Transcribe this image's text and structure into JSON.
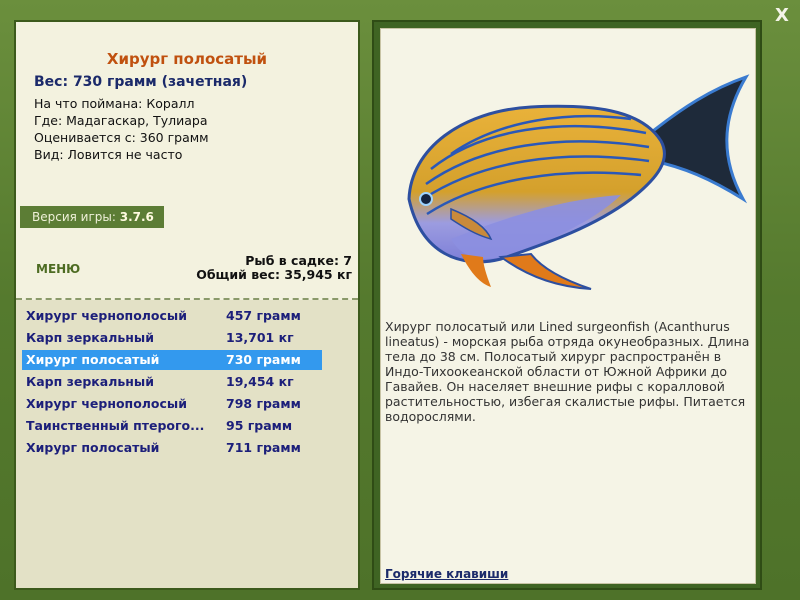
{
  "window": {
    "close_label": "X"
  },
  "fish": {
    "title": "Хирург полосатый",
    "weight": "Вес: 730 грамм (зачетная)",
    "caught_on": "На что поймана: Коралл",
    "location": "Где: Мадагаскар, Тулиара",
    "valued_from": "Оценивается с: 360 грамм",
    "kind": "Вид: Ловится не часто"
  },
  "version": {
    "label": "Версия игры:",
    "value": "3.7.6"
  },
  "menu": {
    "label": "МЕНЮ"
  },
  "stats": {
    "fish_in_keepnet": "Рыб в садке: 7",
    "total_weight": "Общий вес: 35,945 кг"
  },
  "catch_list": [
    {
      "name": "Хирург чернополосый",
      "weight": "457 грамм",
      "selected": false
    },
    {
      "name": "Карп зеркальный",
      "weight": "13,701 кг",
      "selected": false
    },
    {
      "name": "Хирург полосатый",
      "weight": "730 грамм",
      "selected": true
    },
    {
      "name": "Карп зеркальный",
      "weight": "19,454 кг",
      "selected": false
    },
    {
      "name": "Хирург чернополосый",
      "weight": "798 грамм",
      "selected": false
    },
    {
      "name": "Таинственный птерого...",
      "weight": "95 грамм",
      "selected": false
    },
    {
      "name": "Хирург полосатый",
      "weight": "711 грамм",
      "selected": false
    }
  ],
  "description": "Хирург полосатый или Lined surgeonfish (Acanthurus lineatus) - морская рыба отряда окунеобразных. Длина тела до 38 см. Полосатый хирург распространён в Индо-Тихоокеанской области от Южной Африки до Гавайев. Он населяет внешние рифы с коралловой растительностью, избегая скалистые рифы. Питается водорослями.",
  "hotkeys": {
    "label": "Горячие клавиши"
  },
  "colors": {
    "accent_title": "#c0510f",
    "selection": "#3399ee",
    "frame": "#557a2e"
  }
}
